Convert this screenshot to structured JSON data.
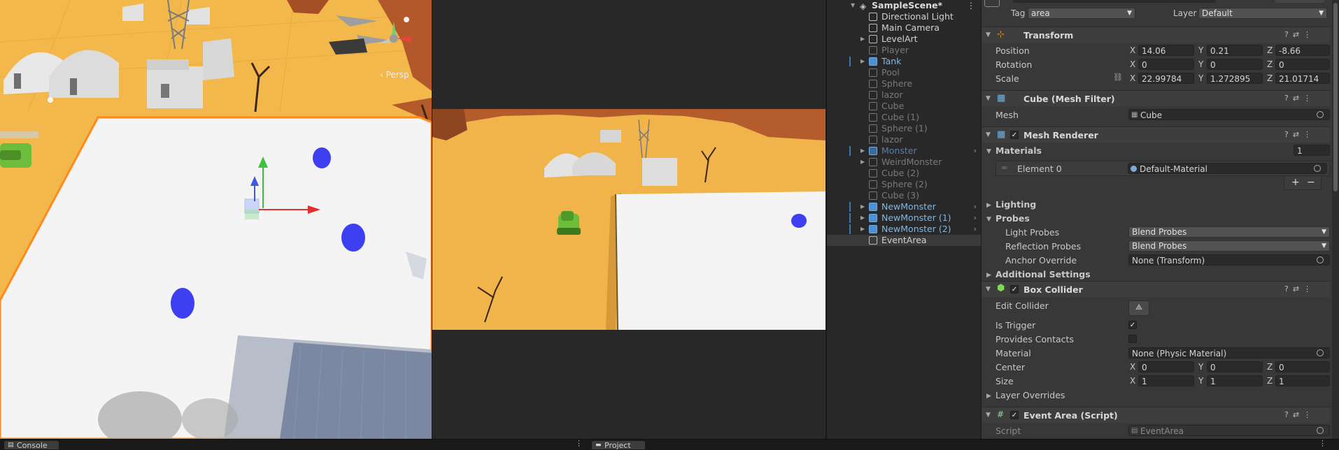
{
  "scene_view": {
    "persp_label": "‹ Persp"
  },
  "hierarchy": {
    "scene_name": "SampleScene*",
    "items": [
      {
        "label": "Directional Light",
        "style": "norm",
        "arrow": false
      },
      {
        "label": "Main Camera",
        "style": "norm",
        "arrow": false
      },
      {
        "label": "LevelArt",
        "style": "norm",
        "arrow": true
      },
      {
        "label": "Player",
        "style": "dim",
        "arrow": false
      },
      {
        "label": "Tank",
        "style": "prefab",
        "arrow": true,
        "marked": true
      },
      {
        "label": "Pool",
        "style": "dim",
        "arrow": false
      },
      {
        "label": "Sphere",
        "style": "dim",
        "arrow": false
      },
      {
        "label": "lazor",
        "style": "dim",
        "arrow": false
      },
      {
        "label": "Cube",
        "style": "dim",
        "arrow": false
      },
      {
        "label": "Cube (1)",
        "style": "dim",
        "arrow": false
      },
      {
        "label": "Sphere (1)",
        "style": "dim",
        "arrow": false
      },
      {
        "label": "lazor",
        "style": "dim",
        "arrow": false
      },
      {
        "label": "Monster",
        "style": "prefab-dim",
        "arrow": true,
        "marked": true,
        "chevron": true
      },
      {
        "label": "WeirdMonster",
        "style": "dim",
        "arrow": true
      },
      {
        "label": "Cube (2)",
        "style": "dim",
        "arrow": false
      },
      {
        "label": "Sphere (2)",
        "style": "dim",
        "arrow": false
      },
      {
        "label": "Cube (3)",
        "style": "dim",
        "arrow": false
      },
      {
        "label": "NewMonster",
        "style": "prefab",
        "arrow": true,
        "marked": true,
        "chevron": true
      },
      {
        "label": "NewMonster (1)",
        "style": "prefab",
        "arrow": true,
        "marked": true,
        "chevron": true
      },
      {
        "label": "NewMonster (2)",
        "style": "prefab",
        "arrow": true,
        "marked": true,
        "chevron": true
      },
      {
        "label": "EventArea",
        "style": "norm",
        "arrow": false,
        "selected": true
      }
    ]
  },
  "inspector": {
    "top": {
      "tag_label": "Tag",
      "tag_value": "area",
      "layer_label": "Layer",
      "layer_value": "Default"
    },
    "transform": {
      "title": "Transform",
      "position_label": "Position",
      "position": {
        "x": "14.06",
        "y": "0.21",
        "z": "-8.66"
      },
      "rotation_label": "Rotation",
      "rotation": {
        "x": "0",
        "y": "0",
        "z": "0"
      },
      "scale_label": "Scale",
      "scale": {
        "x": "22.99784",
        "y": "1.272895",
        "z": "21.01714"
      }
    },
    "mesh_filter": {
      "title": "Cube (Mesh Filter)",
      "mesh_label": "Mesh",
      "mesh_value": "Cube"
    },
    "mesh_renderer": {
      "title": "Mesh Renderer",
      "materials_label": "Materials",
      "materials_count": "1",
      "element0_label": "Element 0",
      "element0_value": "Default-Material",
      "plus": "+",
      "minus": "−",
      "lighting_label": "Lighting",
      "probes_label": "Probes",
      "light_probes_label": "Light Probes",
      "light_probes_value": "Blend Probes",
      "reflection_probes_label": "Reflection Probes",
      "reflection_probes_value": "Blend Probes",
      "anchor_override_label": "Anchor Override",
      "anchor_override_value": "None (Transform)",
      "additional_settings_label": "Additional Settings"
    },
    "box_collider": {
      "title": "Box Collider",
      "edit_collider_label": "Edit Collider",
      "is_trigger_label": "Is Trigger",
      "is_trigger": true,
      "provides_contacts_label": "Provides Contacts",
      "provides_contacts": false,
      "material_label": "Material",
      "material_value": "None (Physic Material)",
      "center_label": "Center",
      "center": {
        "x": "0",
        "y": "0",
        "z": "0"
      },
      "size_label": "Size",
      "size": {
        "x": "1",
        "y": "1",
        "z": "1"
      },
      "layer_overrides_label": "Layer Overrides"
    },
    "event_area": {
      "title": "Event Area (Script)",
      "script_label": "Script",
      "script_value": "EventArea"
    }
  },
  "bottom_tabs": {
    "console": "Console",
    "project": "Project"
  },
  "colors": {
    "selection": "#3a3a3a",
    "prefab": "#7bb7f0",
    "accent_orange": "#ff8a1c",
    "ground": "#f2b84b"
  }
}
